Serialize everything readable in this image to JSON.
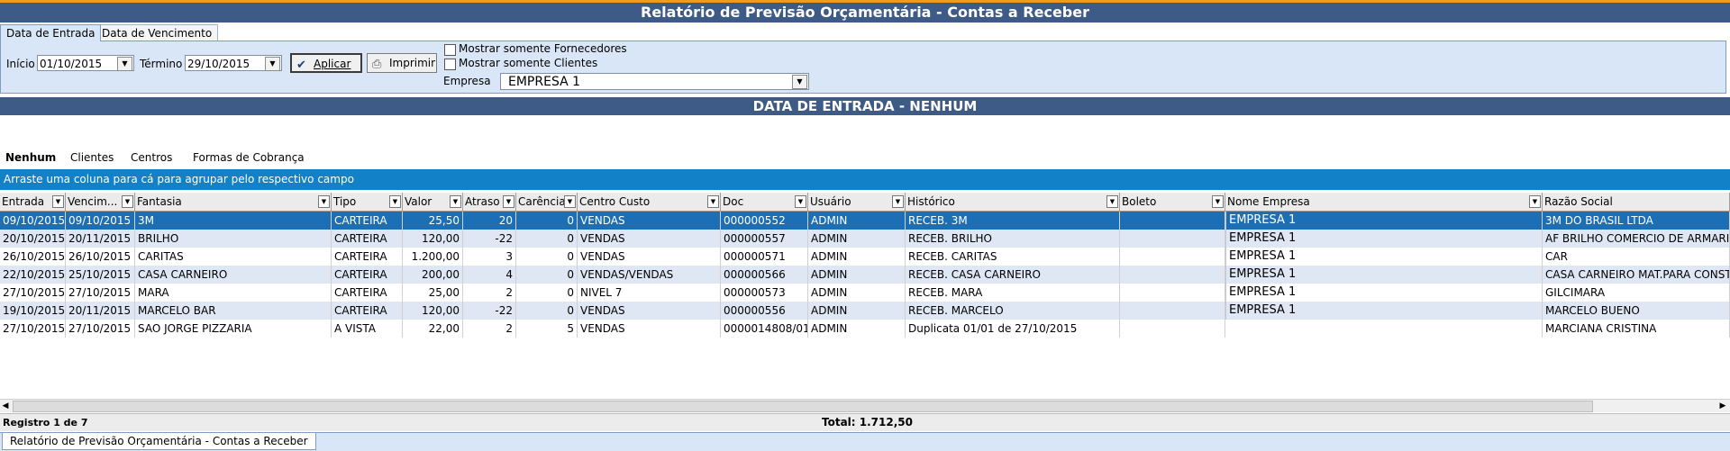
{
  "window": {
    "title": "Relatório de Previsão Orçamentária - Contas a Receber"
  },
  "date_tabs": [
    "Data de Entrada",
    "Data de Vencimento"
  ],
  "filters": {
    "inicio_label": "Início",
    "inicio_value": "01/10/2015",
    "termino_label": "Término",
    "termino_value": "29/10/2015",
    "aplicar_label": "Aplicar",
    "imprimir_label": "Imprimir",
    "chk_fornecedores": "Mostrar somente Fornecedores",
    "chk_clientes": "Mostrar somente Clientes",
    "empresa_label": "Empresa",
    "empresa_value": "EMPRESA 1"
  },
  "section_title": "DATA DE ENTRADA - NENHUM",
  "group_tabs": [
    "Nenhum",
    "Clientes",
    "Centros",
    "Formas de Cobrança"
  ],
  "drag_hint": "Arraste uma coluna para cá para agrupar pelo respectivo campo",
  "columns": [
    "Entrada",
    "Vencim...",
    "Fantasia",
    "Tipo",
    "Valor",
    "Atraso",
    "Carência",
    "Centro Custo",
    "Doc",
    "Usuário",
    "Histórico",
    "Boleto",
    "Nome Empresa",
    "Razão Social"
  ],
  "rows": [
    [
      "09/10/2015",
      "09/10/2015",
      "3M",
      "CARTEIRA",
      "25,50",
      "20",
      "0",
      "VENDAS",
      "000000552",
      "ADMIN",
      "RECEB. 3M",
      "",
      "EMPRESA 1",
      "3M DO BRASIL LTDA"
    ],
    [
      "20/10/2015",
      "20/11/2015",
      "BRILHO",
      "CARTEIRA",
      "120,00",
      "-22",
      "0",
      "VENDAS",
      "000000557",
      "ADMIN",
      "RECEB. BRILHO",
      "",
      "EMPRESA 1",
      "AF BRILHO COMERCIO DE ARMARIN"
    ],
    [
      "26/10/2015",
      "26/10/2015",
      "CARITAS",
      "CARTEIRA",
      "1.200,00",
      "3",
      "0",
      "VENDAS",
      "000000571",
      "ADMIN",
      "RECEB. CARITAS",
      "",
      "EMPRESA 1",
      "CAR"
    ],
    [
      "22/10/2015",
      "25/10/2015",
      "CASA CARNEIRO",
      "CARTEIRA",
      "200,00",
      "4",
      "0",
      "VENDAS/VENDAS",
      "000000566",
      "ADMIN",
      "RECEB. CASA CARNEIRO",
      "",
      "EMPRESA 1",
      "CASA CARNEIRO MAT.PARA CONST"
    ],
    [
      "27/10/2015",
      "27/10/2015",
      "MARA",
      "CARTEIRA",
      "25,00",
      "2",
      "0",
      "NIVEL 7",
      "000000573",
      "ADMIN",
      "RECEB. MARA",
      "",
      "EMPRESA 1",
      "GILCIMARA"
    ],
    [
      "19/10/2015",
      "20/11/2015",
      "MARCELO BAR",
      "CARTEIRA",
      "120,00",
      "-22",
      "0",
      "VENDAS",
      "000000556",
      "ADMIN",
      "RECEB. MARCELO",
      "",
      "EMPRESA 1",
      "MARCELO BUENO"
    ],
    [
      "27/10/2015",
      "27/10/2015",
      "SAO JORGE PIZZARIA",
      "A VISTA",
      "22,00",
      "2",
      "5",
      "VENDAS",
      "0000014808/01",
      "ADMIN",
      "Duplicata 01/01 de 27/10/2015",
      "",
      "",
      "MARCIANA CRISTINA"
    ]
  ],
  "footer": {
    "registro": "Registro 1 de 7",
    "total": "Total: 1.712,50"
  },
  "bottom_tab": "Relatório de Previsão Orçamentária - Contas a Receber",
  "icons": {
    "check": "check-icon",
    "printer": "printer-icon",
    "dropdown": "chevron-down-icon"
  },
  "colors": {
    "title_bar": "#3e5a86",
    "drag_bar": "#1381c7",
    "selected_row": "#1c6fb5",
    "accent_top": "#f29a1e"
  }
}
